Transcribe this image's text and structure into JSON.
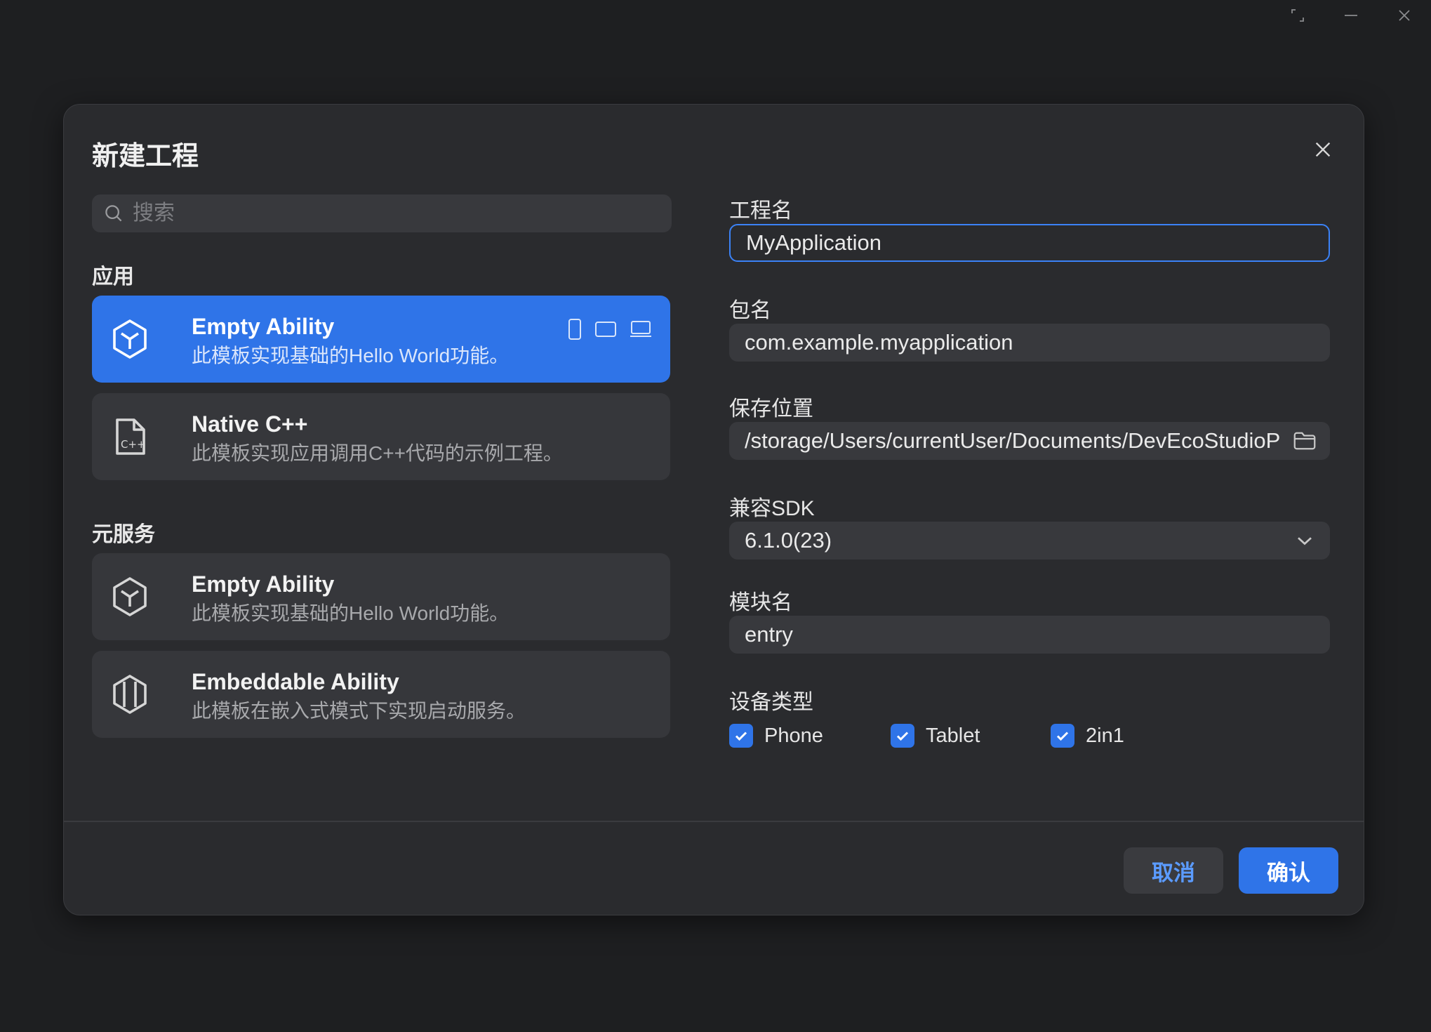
{
  "window": {
    "controls": [
      "restore-icon",
      "minimize-icon",
      "close-icon"
    ]
  },
  "dialog": {
    "title": "新建工程",
    "close_icon": "close-icon"
  },
  "search": {
    "placeholder": "搜索",
    "icon": "search-icon"
  },
  "sections": {
    "app": "应用",
    "atomic": "元服务"
  },
  "templates": {
    "app": [
      {
        "title": "Empty Ability",
        "desc": "此模板实现基础的Hello World功能。",
        "icon": "cube-icon",
        "selected": true,
        "devices": [
          "phone-icon",
          "tablet-icon",
          "laptop-icon"
        ]
      },
      {
        "title": "Native C++",
        "desc": "此模板实现应用调用C++代码的示例工程。",
        "icon": "cpp-file-icon",
        "selected": false
      }
    ],
    "atomic": [
      {
        "title": "Empty Ability",
        "desc": "此模板实现基础的Hello World功能。",
        "icon": "cube-icon",
        "selected": false
      },
      {
        "title": "Embeddable Ability",
        "desc": "此模板在嵌入式模式下实现启动服务。",
        "icon": "embed-icon",
        "selected": false
      }
    ]
  },
  "form": {
    "project_name": {
      "label": "工程名",
      "value": "MyApplication"
    },
    "package_name": {
      "label": "包名",
      "value": "com.example.myapplication"
    },
    "save_location": {
      "label": "保存位置",
      "value": "/storage/Users/currentUser/Documents/DevEcoStudioP",
      "icon": "folder-icon"
    },
    "sdk": {
      "label": "兼容SDK",
      "value": "6.1.0(23)",
      "icon": "chevron-down-icon"
    },
    "module_name": {
      "label": "模块名",
      "value": "entry"
    },
    "device_type": {
      "label": "设备类型",
      "options": [
        {
          "label": "Phone",
          "checked": true
        },
        {
          "label": "Tablet",
          "checked": true
        },
        {
          "label": "2in1",
          "checked": true
        }
      ]
    }
  },
  "buttons": {
    "cancel": "取消",
    "confirm": "确认"
  },
  "colors": {
    "accent": "#2f74e8",
    "background": "#1e1f21",
    "dialog": "#2a2b2e"
  }
}
